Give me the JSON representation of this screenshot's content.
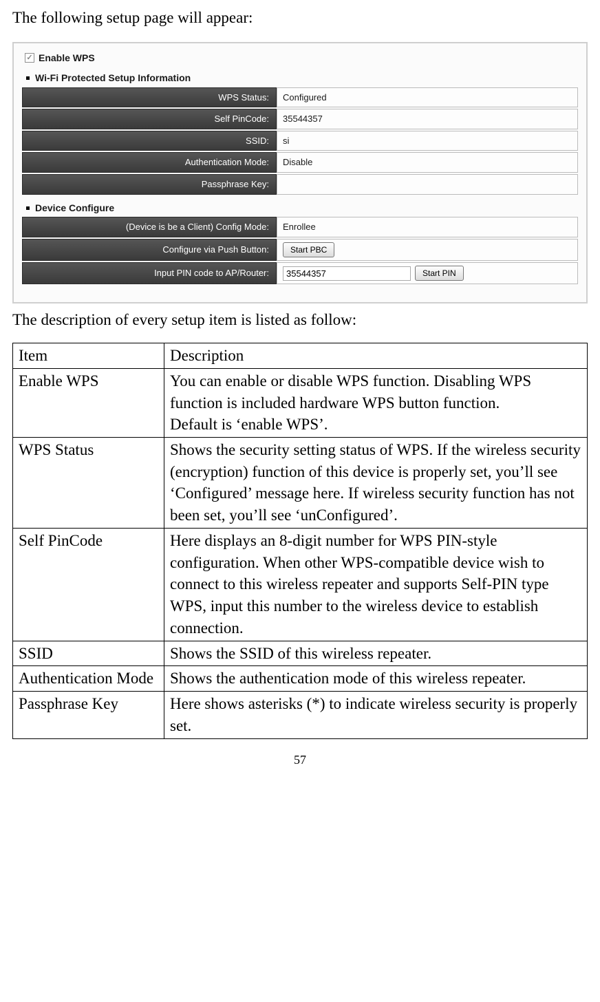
{
  "intro_text": "The following setup page will appear:",
  "panel": {
    "enable_wps": {
      "label": "Enable WPS",
      "checked": true
    },
    "section1": "Wi-Fi Protected Setup Information",
    "section2": "Device Configure",
    "rows": {
      "wps_status": {
        "label": "WPS Status:",
        "value": "Configured"
      },
      "self_pincode": {
        "label": "Self PinCode:",
        "value": "35544357"
      },
      "ssid": {
        "label": "SSID:",
        "value": "si"
      },
      "auth_mode": {
        "label": "Authentication Mode:",
        "value": "Disable"
      },
      "passphrase": {
        "label": "Passphrase Key:",
        "value": ""
      },
      "config_mode": {
        "label": "(Device is be a Client)  Config Mode:",
        "value": "Enrollee"
      },
      "push_button": {
        "label": "Configure via Push Button:",
        "button": "Start PBC"
      },
      "pin_input": {
        "label": "Input PIN code to AP/Router:",
        "value": "35544357",
        "button": "Start PIN"
      }
    }
  },
  "desc_follow": "The description of every setup item is listed as follow:",
  "table": {
    "header": {
      "item": "Item",
      "desc": "Description"
    },
    "rows": [
      {
        "item": "Enable WPS",
        "desc": "You can enable or disable WPS function. Disabling WPS function is included hardware WPS button function.\nDefault is ‘enable WPS’."
      },
      {
        "item": "WPS Status",
        "desc": "Shows the security setting status of WPS. If the wireless security (encryption) function of this device is properly set, you’ll see ‘Configured’ message here. If wireless security function has not been set, you’ll see ‘unConfigured’."
      },
      {
        "item": "Self PinCode",
        "desc": "Here displays an 8-digit number for WPS PIN-style configuration. When other WPS-compatible device wish to connect to this wireless repeater and supports Self-PIN type WPS, input this number to the wireless device to establish connection."
      },
      {
        "item": "SSID",
        "desc": "Shows the SSID of this wireless repeater."
      },
      {
        "item": "Authentication Mode",
        "desc": "Shows the authentication mode of this wireless repeater."
      },
      {
        "item": "Passphrase Key",
        "desc": "Here shows asterisks (*) to indicate wireless security is properly set."
      }
    ]
  },
  "page_number": "57"
}
